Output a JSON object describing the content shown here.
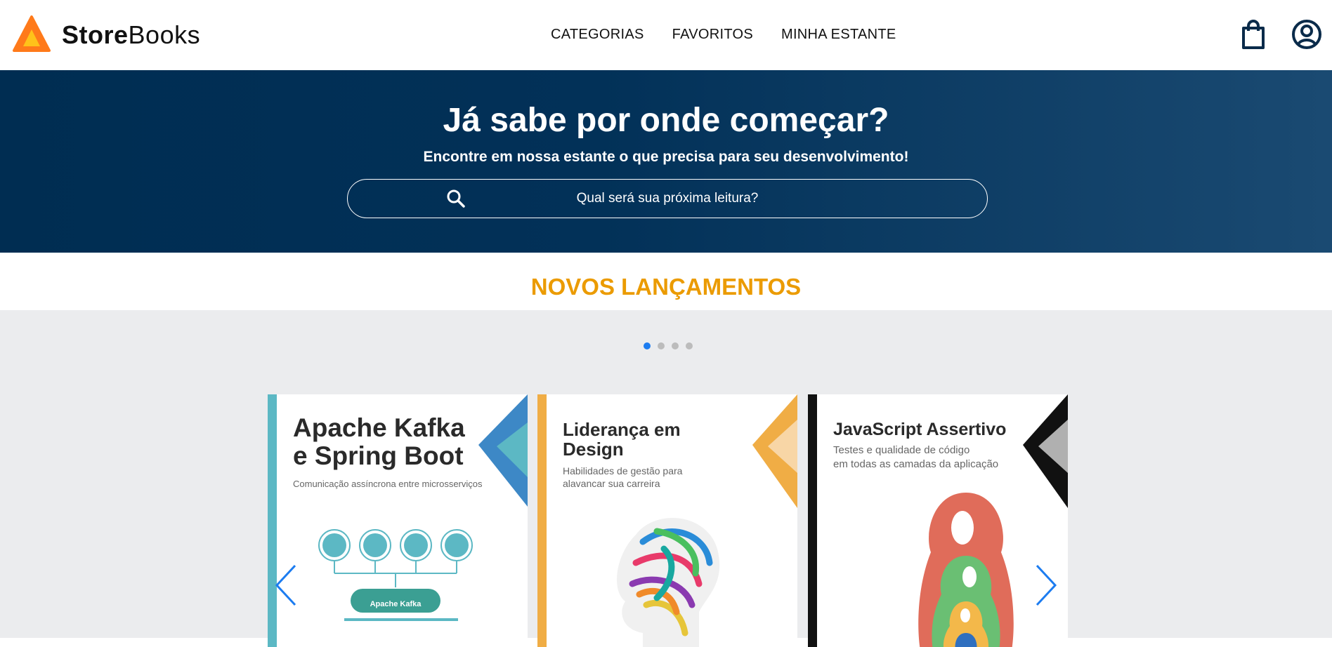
{
  "brand": {
    "store": "Store",
    "books": "Books",
    "accent": "#ff7a1a"
  },
  "nav": {
    "items": [
      "CATEGORIAS",
      "FAVORITOS",
      "MINHA ESTANTE"
    ]
  },
  "header_icons": [
    "shopping-bag-icon",
    "user-circle-icon"
  ],
  "hero": {
    "title": "Já sabe por onde começar?",
    "subtitle": "Encontre em nossa estante o que precisa para seu desenvolvimento!",
    "search_placeholder": "Qual será sua próxima leitura?"
  },
  "releases": {
    "title": "NOVOS LANÇAMENTOS",
    "accent": "#eb9b00",
    "pages": 4,
    "active_page": 1,
    "books": [
      {
        "title_line1": "Apache Kafka",
        "title_line2": "e Spring Boot",
        "subtitle": "Comunicação assíncrona entre microsserviços",
        "accent": "#5cb8c4",
        "cover_label": "Apache Kafka"
      },
      {
        "title_line1": "Liderança em",
        "title_line2": "Design",
        "subtitle_line1": "Habilidades de gestão para",
        "subtitle_line2": "alavancar sua carreira",
        "accent": "#f0ad45"
      },
      {
        "title_line1": "JavaScript Assertivo",
        "subtitle_line1": "Testes e qualidade de código",
        "subtitle_line2": "em todas as camadas da aplicação",
        "accent": "#111111"
      }
    ]
  }
}
